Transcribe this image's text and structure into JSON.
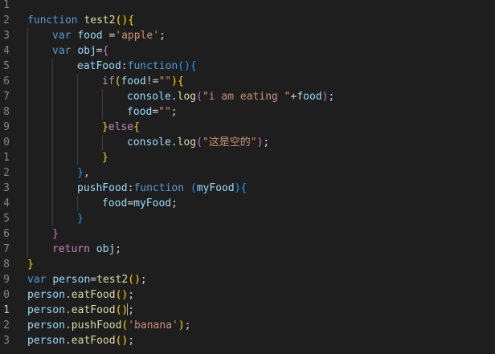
{
  "line_numbers": [
    "1",
    "2",
    "3",
    "4",
    "5",
    "6",
    "7",
    "8",
    "9",
    "0",
    "1",
    "2",
    "3",
    "4",
    "5",
    "6",
    "7",
    "8",
    "9",
    "0",
    "1",
    "2",
    "3"
  ],
  "active_line": 20,
  "lines": [
    [],
    [
      {
        "t": "function",
        "c": "kw"
      },
      {
        "t": " ",
        "c": "pl"
      },
      {
        "t": "test2",
        "c": "fn"
      },
      {
        "t": "()",
        "c": "br1"
      },
      {
        "t": "{",
        "c": "br1"
      }
    ],
    [
      {
        "t": "var",
        "c": "kw"
      },
      {
        "t": " ",
        "c": "pl"
      },
      {
        "t": "food",
        "c": "var"
      },
      {
        "t": " =",
        "c": "pl"
      },
      {
        "t": "'apple'",
        "c": "str"
      },
      {
        "t": ";",
        "c": "pl"
      }
    ],
    [
      {
        "t": "var",
        "c": "kw"
      },
      {
        "t": " ",
        "c": "pl"
      },
      {
        "t": "obj",
        "c": "var"
      },
      {
        "t": "=",
        "c": "pl"
      },
      {
        "t": "{",
        "c": "br2"
      }
    ],
    [
      {
        "t": "eatFood",
        "c": "var"
      },
      {
        "t": ":",
        "c": "pl"
      },
      {
        "t": "function",
        "c": "kw"
      },
      {
        "t": "()",
        "c": "br3"
      },
      {
        "t": "{",
        "c": "br3"
      }
    ],
    [
      {
        "t": "if",
        "c": "kw2"
      },
      {
        "t": "(",
        "c": "br1"
      },
      {
        "t": "food",
        "c": "var"
      },
      {
        "t": "!=",
        "c": "pl"
      },
      {
        "t": "\"\"",
        "c": "str"
      },
      {
        "t": ")",
        "c": "br1"
      },
      {
        "t": "{",
        "c": "br1"
      }
    ],
    [
      {
        "t": "console",
        "c": "var"
      },
      {
        "t": ".",
        "c": "pl"
      },
      {
        "t": "log",
        "c": "fn"
      },
      {
        "t": "(",
        "c": "br2"
      },
      {
        "t": "\"i am eating \"",
        "c": "str"
      },
      {
        "t": "+",
        "c": "pl"
      },
      {
        "t": "food",
        "c": "var"
      },
      {
        "t": ")",
        "c": "br2"
      },
      {
        "t": ";",
        "c": "pl"
      }
    ],
    [
      {
        "t": "food",
        "c": "var"
      },
      {
        "t": "=",
        "c": "pl"
      },
      {
        "t": "\"\"",
        "c": "str"
      },
      {
        "t": ";",
        "c": "pl"
      }
    ],
    [
      {
        "t": "}",
        "c": "br1"
      },
      {
        "t": "else",
        "c": "kw2"
      },
      {
        "t": "{",
        "c": "br1"
      }
    ],
    [
      {
        "t": "console",
        "c": "var"
      },
      {
        "t": ".",
        "c": "pl"
      },
      {
        "t": "log",
        "c": "fn"
      },
      {
        "t": "(",
        "c": "br2"
      },
      {
        "t": "\"这是空的\"",
        "c": "str"
      },
      {
        "t": ")",
        "c": "br2"
      },
      {
        "t": ";",
        "c": "pl"
      }
    ],
    [
      {
        "t": "}",
        "c": "br1"
      }
    ],
    [
      {
        "t": "}",
        "c": "br3"
      },
      {
        "t": ",",
        "c": "pl"
      }
    ],
    [
      {
        "t": "pushFood",
        "c": "var"
      },
      {
        "t": ":",
        "c": "pl"
      },
      {
        "t": "function",
        "c": "kw"
      },
      {
        "t": " ",
        "c": "pl"
      },
      {
        "t": "(",
        "c": "br3"
      },
      {
        "t": "myFood",
        "c": "var"
      },
      {
        "t": ")",
        "c": "br3"
      },
      {
        "t": "{",
        "c": "br3"
      }
    ],
    [
      {
        "t": "food",
        "c": "var"
      },
      {
        "t": "=",
        "c": "pl"
      },
      {
        "t": "myFood",
        "c": "var"
      },
      {
        "t": ";",
        "c": "pl"
      }
    ],
    [
      {
        "t": "}",
        "c": "br3"
      }
    ],
    [
      {
        "t": "}",
        "c": "br2"
      }
    ],
    [
      {
        "t": "return",
        "c": "kw2"
      },
      {
        "t": " ",
        "c": "pl"
      },
      {
        "t": "obj",
        "c": "var"
      },
      {
        "t": ";",
        "c": "pl"
      }
    ],
    [
      {
        "t": "}",
        "c": "br1"
      }
    ],
    [
      {
        "t": "var",
        "c": "kw"
      },
      {
        "t": " ",
        "c": "pl"
      },
      {
        "t": "person",
        "c": "var"
      },
      {
        "t": "=",
        "c": "pl"
      },
      {
        "t": "test2",
        "c": "fn"
      },
      {
        "t": "()",
        "c": "br1"
      },
      {
        "t": ";",
        "c": "pl"
      }
    ],
    [
      {
        "t": "person",
        "c": "var"
      },
      {
        "t": ".",
        "c": "pl"
      },
      {
        "t": "eatFood",
        "c": "fn"
      },
      {
        "t": "()",
        "c": "br1"
      },
      {
        "t": ";",
        "c": "pl"
      }
    ],
    [
      {
        "t": "person",
        "c": "var"
      },
      {
        "t": ".",
        "c": "pl"
      },
      {
        "t": "eatFood",
        "c": "fn"
      },
      {
        "t": "()",
        "c": "br1"
      },
      {
        "t": ";",
        "c": "pl"
      }
    ],
    [
      {
        "t": "person",
        "c": "var"
      },
      {
        "t": ".",
        "c": "pl"
      },
      {
        "t": "pushFood",
        "c": "fn"
      },
      {
        "t": "(",
        "c": "br1"
      },
      {
        "t": "'banana'",
        "c": "str"
      },
      {
        "t": ")",
        "c": "br1"
      },
      {
        "t": ";",
        "c": "pl"
      }
    ],
    [
      {
        "t": "person",
        "c": "var"
      },
      {
        "t": ".",
        "c": "pl"
      },
      {
        "t": "eatFood",
        "c": "fn"
      },
      {
        "t": "()",
        "c": "br1"
      },
      {
        "t": ";",
        "c": "pl"
      }
    ]
  ],
  "colors": {
    "background": "#1e1e1e",
    "keyword": "#569cd6",
    "control_keyword": "#c586c0",
    "function_name": "#dcdcaa",
    "variable": "#9cdcfe",
    "string": "#ce9178",
    "line_number": "#858585"
  }
}
